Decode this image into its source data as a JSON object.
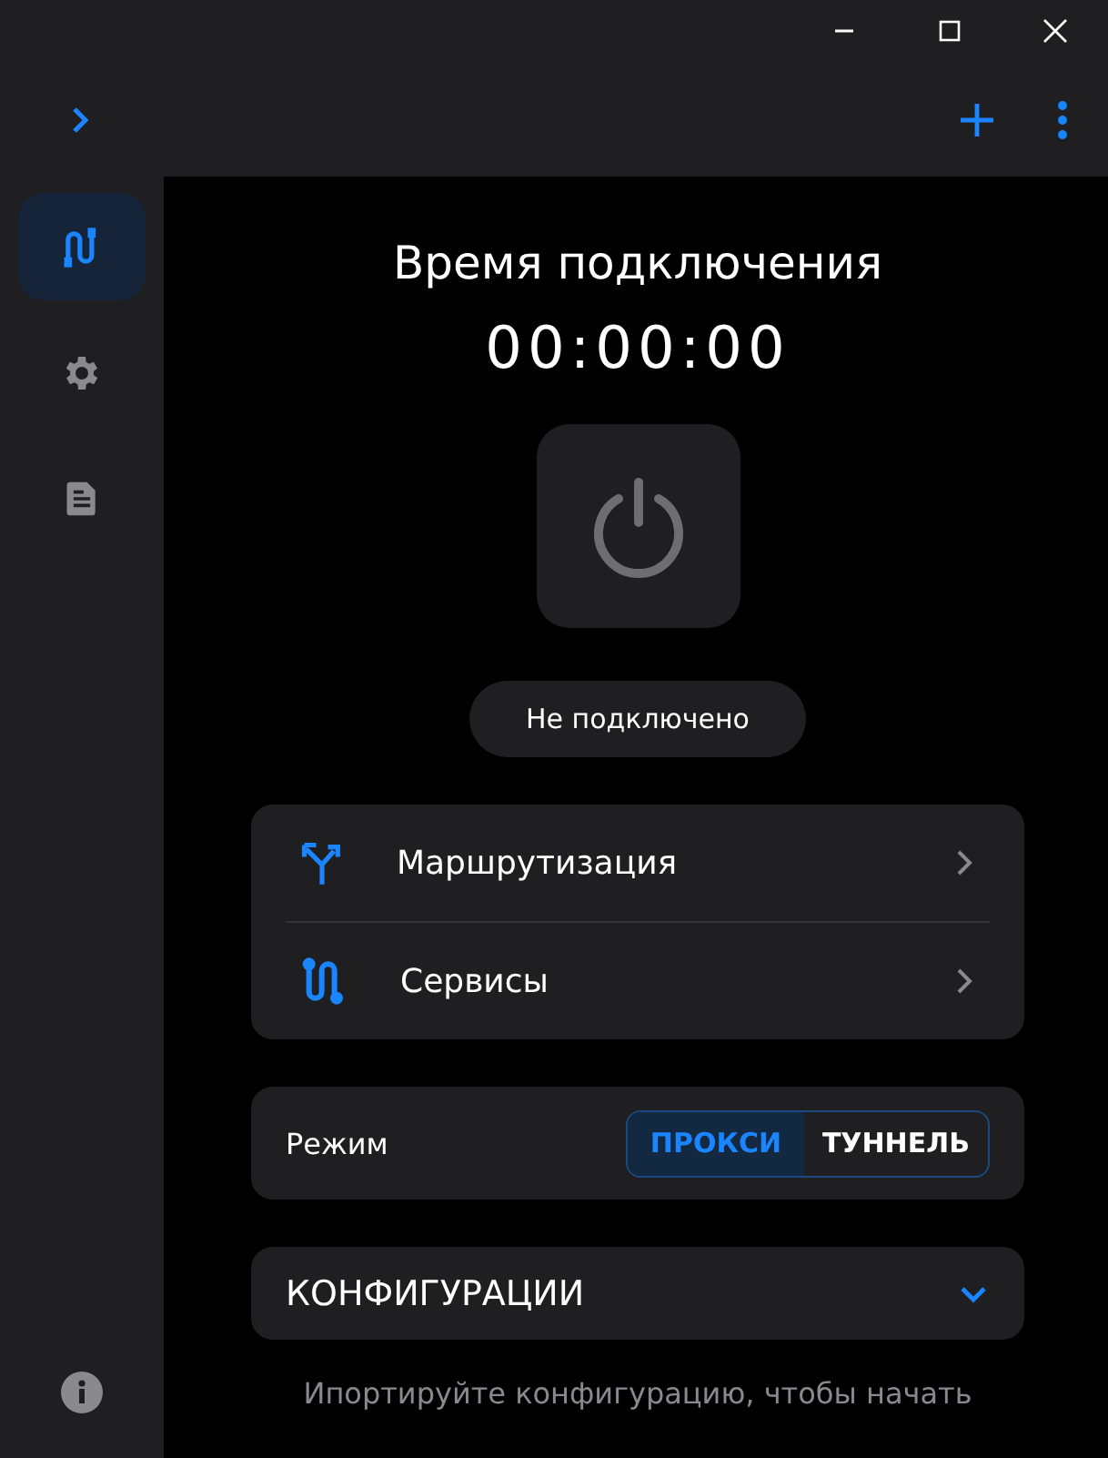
{
  "sidebar": {
    "items": [
      {
        "kind": "routes",
        "selected": true
      },
      {
        "kind": "settings",
        "selected": false
      },
      {
        "kind": "document",
        "selected": false
      }
    ]
  },
  "connection": {
    "title": "Время подключения",
    "timer": "00:00:00",
    "status": "Не подключено",
    "connected": false
  },
  "menu": [
    {
      "kind": "routing",
      "label": "Маршрутизация"
    },
    {
      "kind": "services",
      "label": "Сервисы"
    }
  ],
  "mode": {
    "label": "Режим",
    "options": [
      {
        "label": "ПРОКСИ",
        "selected": true
      },
      {
        "label": "ТУННЕЛЬ",
        "selected": false
      }
    ]
  },
  "configurations": {
    "title": "КОНФИГУРАЦИИ",
    "expanded": true,
    "hint": "Ипортируйте конфигурацию, чтобы начать"
  }
}
